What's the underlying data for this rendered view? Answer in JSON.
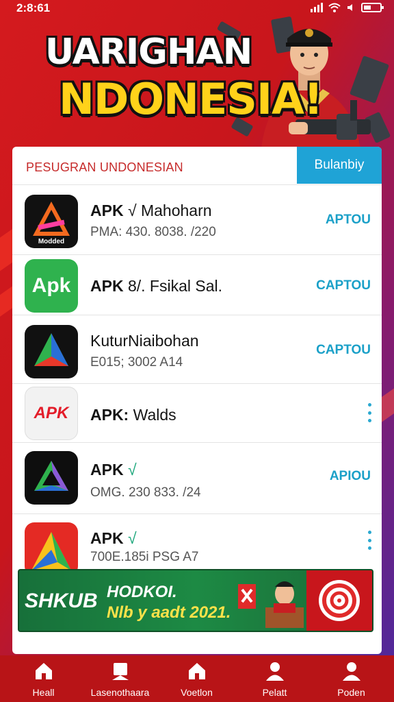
{
  "status_bar": {
    "time": "2:8:61"
  },
  "hero": {
    "title_line1": "UARIGHAN",
    "title_line2": "NDONESIA!"
  },
  "card": {
    "title": "PESUGRAN UNDONESIAN",
    "header_button": "Bulanbiy",
    "apps": [
      {
        "name_bold": "APK",
        "name_rest": "√ Mahoharn",
        "meta": "PMA: 430. 8038. /220",
        "action": "APTOU",
        "action_type": "button"
      },
      {
        "name_bold": "APK",
        "name_rest": "8/. Fsikal Sal.",
        "meta": "",
        "action": "CAPTOU",
        "action_type": "button"
      },
      {
        "name_bold": "",
        "name_rest": "KuturNiaibohan",
        "meta": "E015; 3002 A14",
        "action": "CAPTOU",
        "action_type": "button"
      },
      {
        "name_bold": "APK:",
        "name_rest": "Walds",
        "meta": "",
        "action": "",
        "action_type": "menu"
      },
      {
        "name_bold": "APK",
        "name_rest": "√",
        "meta": "OMG. 230 833. /24",
        "action": "APIOU",
        "action_type": "button"
      },
      {
        "name_bold": "APK",
        "name_rest": "√",
        "meta": "700E.185i PSG A7",
        "action": "",
        "action_type": "menu"
      }
    ],
    "icon_texts": {
      "app1": "Modded",
      "app2": "Apk",
      "app4": "APK"
    }
  },
  "banner": {
    "brand": "SHKUB",
    "line1": "HODKOI.",
    "line2": "Nlb y aadt 2021."
  },
  "bottom_nav": [
    {
      "label": "Heall",
      "icon": "home-icon"
    },
    {
      "label": "Lasenothaara",
      "icon": "profile-icon"
    },
    {
      "label": "Voetlon",
      "icon": "home-icon"
    },
    {
      "label": "Pelatt",
      "icon": "user-icon"
    },
    {
      "label": "Poden",
      "icon": "user-icon"
    }
  ],
  "colors": {
    "primary_red": "#b81417",
    "accent_blue": "#1fa3d6",
    "title_yellow": "#ffd21a"
  }
}
